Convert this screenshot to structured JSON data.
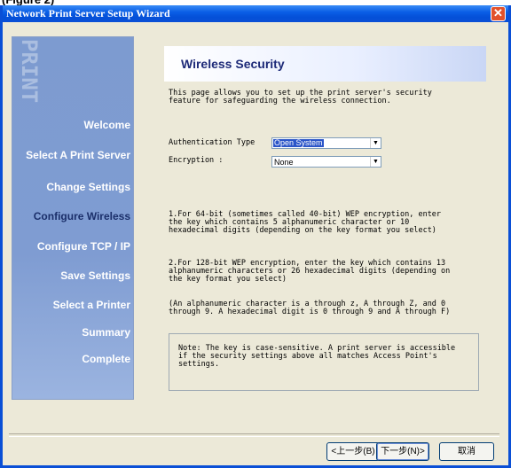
{
  "window": {
    "title": "Network Print Server Setup Wizard",
    "close_glyph": "✕"
  },
  "sidebar": {
    "brand": "PRINT",
    "items": [
      {
        "label": "Welcome",
        "active": false
      },
      {
        "label": "Select A Print Server",
        "active": false
      },
      {
        "label": "Change Settings",
        "active": false
      },
      {
        "label": "Configure Wireless",
        "active": true
      },
      {
        "label": "Configure TCP / IP",
        "active": false
      },
      {
        "label": "Save Settings",
        "active": false
      },
      {
        "label": "Select a Printer",
        "active": false
      },
      {
        "label": "Summary",
        "active": false
      },
      {
        "label": "Complete",
        "active": false
      }
    ]
  },
  "page": {
    "title": "Wireless Security",
    "intro": "This page allows you to set up the print server's security\nfeature for safeguarding the wireless connection.",
    "auth_label": "Authentication Type",
    "auth_value": "Open System",
    "enc_label": "Encryption :",
    "enc_value": "None",
    "info1": "1.For 64-bit (sometimes called 40-bit) WEP encryption, enter\nthe key which contains 5 alphanumeric character or 10\nhexadecimal digits (depending on the key format you select)",
    "info2": "2.For 128-bit WEP encryption, enter the key which contains 13\nalphanumeric characters or 26 hexadecimal digits (depending on\nthe key format you select)",
    "info3": "(An alphanumeric character is a through z, A through Z, and 0\nthrough 9. A hexadecimal digit is 0 through 9 and A through F)",
    "note": "Note: The key is case-sensitive. A print server is accessible\nif the security settings above all matches Access Point's\nsettings."
  },
  "buttons": {
    "back": "<上一步(B)",
    "next": "下一步(N)>",
    "cancel": "取消"
  },
  "colors": {
    "titlebar": "#0a5ee6",
    "sidebar": "#7f9cd2",
    "header_text": "#1d2a78",
    "selection": "#2b55c8"
  }
}
